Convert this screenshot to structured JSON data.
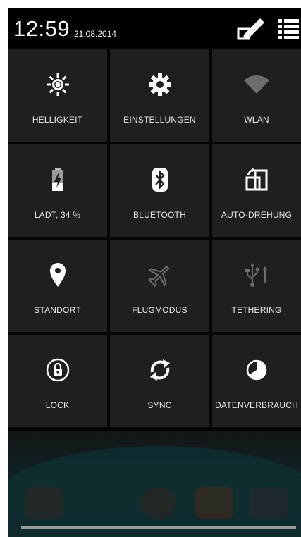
{
  "status": {
    "time": "12:59",
    "date": "21.08.2014"
  },
  "actions": {
    "edit_icon": "pencil-edit-icon",
    "list_icon": "list-view-icon"
  },
  "tiles": [
    {
      "label": "HELLIGKEIT",
      "icon": "brightness-icon",
      "active": true
    },
    {
      "label": "EINSTELLUNGEN",
      "icon": "gear-icon",
      "active": true
    },
    {
      "label": "WLAN",
      "icon": "wifi-icon",
      "active": false
    },
    {
      "label": "LÄDT, 34 %",
      "icon": "battery-charging-icon",
      "active": true
    },
    {
      "label": "BLUETOOTH",
      "icon": "bluetooth-icon",
      "active": true
    },
    {
      "label": "AUTO-DREHUNG",
      "icon": "auto-rotate-icon",
      "active": true
    },
    {
      "label": "STANDORT",
      "icon": "location-icon",
      "active": true
    },
    {
      "label": "FLUGMODUS",
      "icon": "airplane-icon",
      "active": false
    },
    {
      "label": "TETHERING",
      "icon": "usb-tethering-icon",
      "active": false
    },
    {
      "label": "LOCK",
      "icon": "lock-icon",
      "active": true
    },
    {
      "label": "SYNC",
      "icon": "sync-icon",
      "active": true
    },
    {
      "label": "DATENVERBRAUCH",
      "icon": "data-usage-icon",
      "active": true
    }
  ],
  "colors": {
    "tile_bg": "#1f1f1f",
    "panel_bg": "#050505",
    "text": "#e8e8e8"
  }
}
